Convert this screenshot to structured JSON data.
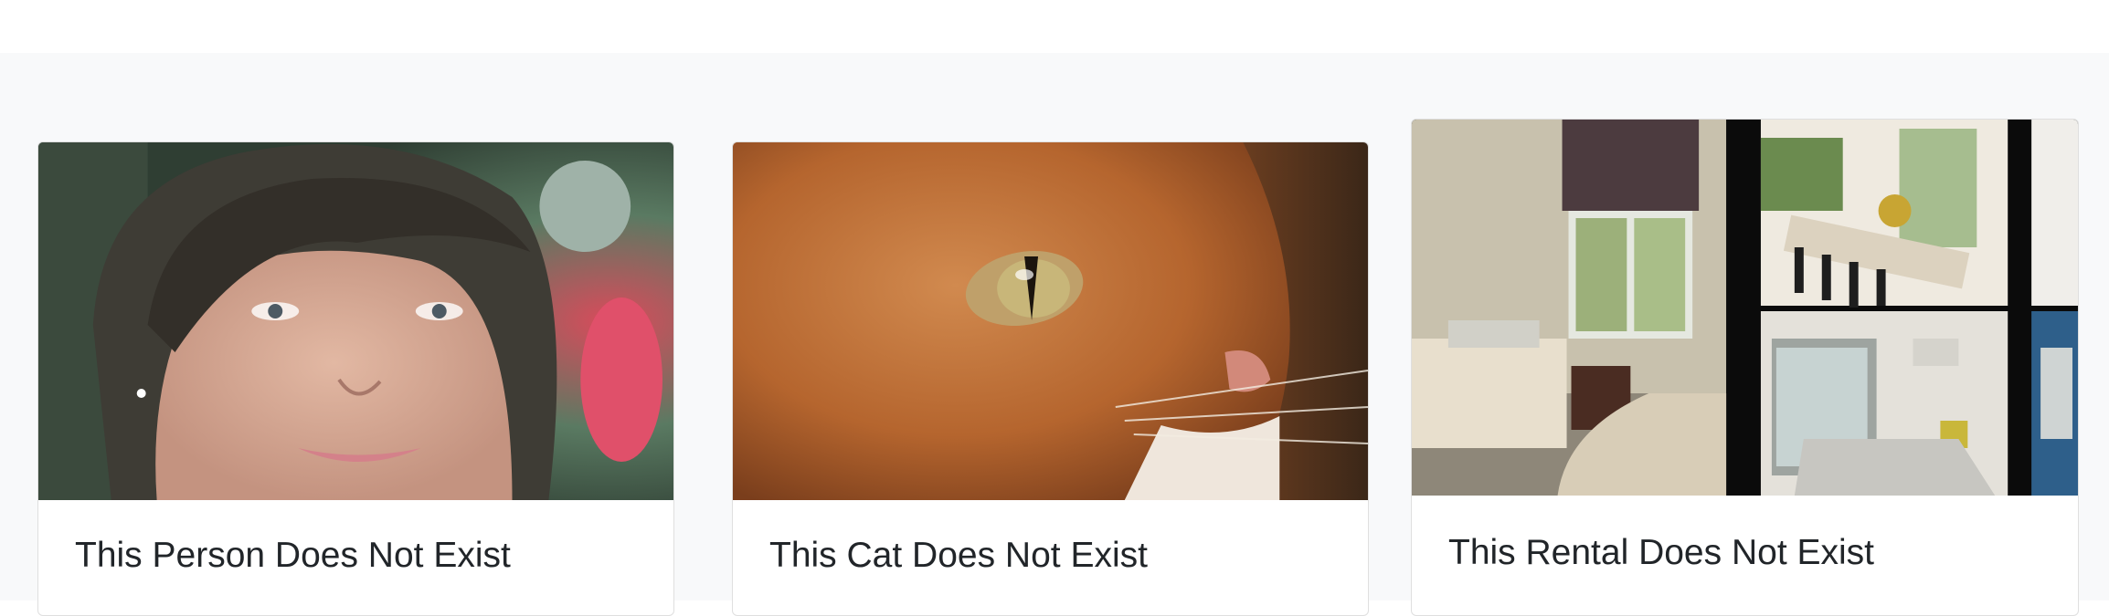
{
  "cards": [
    {
      "title": "This Person Does Not Exist",
      "image": "generated-person-photo"
    },
    {
      "title": "This Cat Does Not Exist",
      "image": "generated-cat-photo"
    },
    {
      "title": "This Rental Does Not Exist",
      "image": "generated-rental-photo-collage"
    }
  ],
  "colors": {
    "section_background": "#f8f9fa",
    "card_background": "#ffffff",
    "title_text": "#212529"
  }
}
